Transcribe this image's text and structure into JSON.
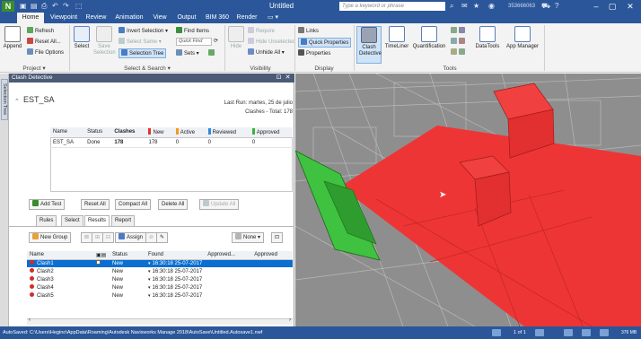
{
  "titlebar": {
    "logo": "N",
    "title": "Untitled",
    "search_placeholder": "Type a keyword or phrase",
    "user": "353666063",
    "icons": [
      "save-icon",
      "undo-icon",
      "redo-icon",
      "print-icon",
      "binoculars-icon",
      "star-icon",
      "user-icon",
      "cart-icon",
      "help-icon"
    ]
  },
  "tabs": [
    "Home",
    "Viewpoint",
    "Review",
    "Animation",
    "View",
    "Output",
    "BIM 360",
    "Render"
  ],
  "ribbon": {
    "groups": [
      "Project",
      "Select & Search",
      "Visibility",
      "Display",
      "Tools"
    ],
    "buttons": {
      "append": "Append",
      "refresh": "Refresh",
      "reset_all": "Reset All...",
      "file_options": "File Options",
      "select": "Select",
      "save_selection": "Save Selection",
      "invert_selection": "Invert Selection",
      "select_same": "Select Same",
      "selection_tree": "Selection Tree",
      "find_items": "Find Items",
      "quick_find": "Quick Find",
      "sets": "Sets",
      "hide": "Hide",
      "require": "Require",
      "hide_unselected": "Hide Unselected",
      "unhide_all": "Unhide All",
      "links": "Links",
      "quick_properties": "Quick Properties",
      "properties": "Properties",
      "clash_detective": "Clash Detective",
      "timeliner": "TimeLiner",
      "quantification": "Quantification",
      "datatools": "DataTools",
      "app_manager": "App Manager"
    }
  },
  "side_tab": "Selection Tree",
  "panel": {
    "title": "Clash Detective",
    "test_name": "EST_SA",
    "last_run": "Last Run: martes, 25 de julio",
    "clashes_total": "Clashes - Total: 178",
    "tests_columns": [
      "Name",
      "Status",
      "Clashes",
      "New",
      "Active",
      "Reviewed",
      "Approved"
    ],
    "tests_rows": [
      [
        "EST_SA",
        "Done",
        "178",
        "178",
        "0",
        "0",
        "0"
      ]
    ],
    "buttons": {
      "add_test": "Add Test",
      "reset_all": "Reset All",
      "compact_all": "Compact All",
      "delete_all": "Delete All",
      "update_all": "Update All"
    },
    "subtabs": [
      "Rules",
      "Select",
      "Results",
      "Report"
    ],
    "results_toolbar": {
      "new_group": "New Group",
      "assign": "Assign",
      "none": "None"
    },
    "results_columns": [
      "Name",
      "",
      "Status",
      "Found",
      "Approved...",
      "Approved"
    ],
    "results_rows": [
      {
        "name": "Clash1",
        "status": "New",
        "found": "16:30:18 25-07-2017",
        "selected": true
      },
      {
        "name": "Clash2",
        "status": "New",
        "found": "16:30:18 25-07-2017",
        "selected": false
      },
      {
        "name": "Clash3",
        "status": "New",
        "found": "16:30:18 25-07-2017",
        "selected": false
      },
      {
        "name": "Clash4",
        "status": "New",
        "found": "16:30:18 25-07-2017",
        "selected": false
      },
      {
        "name": "Clash5",
        "status": "New",
        "found": "16:30:18 25-07-2017",
        "selected": false
      }
    ]
  },
  "statusbar": {
    "text": "AutoSaved: C:\\Users\\Hegino\\AppData\\Roaming\\Autodesk Navisworks Manage 2018\\AutoSave\\Untitled.Autosave1.nwf",
    "page": "1 of 1",
    "memory": "376 MB"
  },
  "colors": {
    "chrome_blue": "#2b579a",
    "ribbon_bg": "#f3f3f3",
    "clash_red": "#ee3535",
    "clash_green": "#3fc23f",
    "selection_blue": "#0a6fd1",
    "new_status": "#e5322d",
    "active_status": "#f39a1d",
    "reviewed_status": "#2b8ae0",
    "approved_status": "#37b437"
  }
}
